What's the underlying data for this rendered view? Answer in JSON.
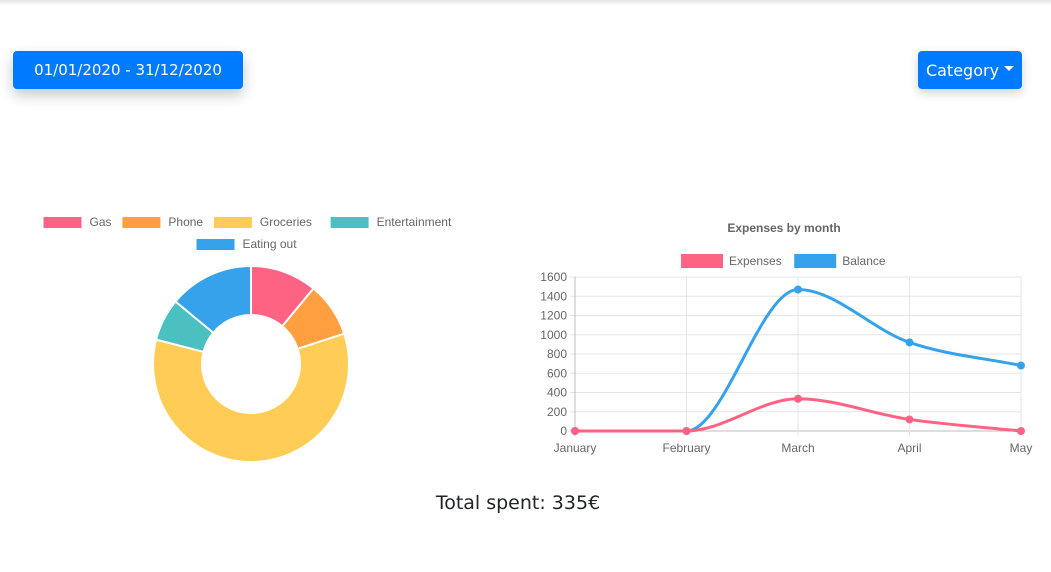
{
  "controls": {
    "date_range_label": "01/01/2020 - 31/12/2020",
    "category_label": "Category"
  },
  "colors": {
    "primary": "#007bff",
    "gas": "#ff6384",
    "phone": "#ff9f40",
    "groceries": "#ffcd56",
    "entertainment": "#4bc0c0",
    "eating_out": "#36a2eb"
  },
  "chart_data": [
    {
      "type": "pie",
      "variant": "doughnut",
      "title": "",
      "legend_position": "top",
      "labels": [
        "Gas",
        "Phone",
        "Groceries",
        "Entertainment",
        "Eating out"
      ],
      "values": [
        11,
        9,
        59,
        7,
        14
      ],
      "colors": [
        "#ff6384",
        "#ff9f40",
        "#ffcd56",
        "#4bc0c0",
        "#36a2eb"
      ]
    },
    {
      "type": "line",
      "title": "Expenses by month",
      "legend_position": "top",
      "grid": true,
      "categories": [
        "January",
        "February",
        "March",
        "April",
        "May"
      ],
      "ylim": [
        0,
        1600
      ],
      "yticks": [
        0,
        200,
        400,
        600,
        800,
        1000,
        1200,
        1400,
        1600
      ],
      "series": [
        {
          "name": "Expenses",
          "color": "#ff6384",
          "values": [
            0,
            0,
            335,
            120,
            0
          ]
        },
        {
          "name": "Balance",
          "color": "#36a2eb",
          "values": [
            0,
            0,
            1470,
            920,
            680
          ]
        }
      ]
    }
  ],
  "summary": {
    "total_spent": "Total spent: 335€"
  }
}
